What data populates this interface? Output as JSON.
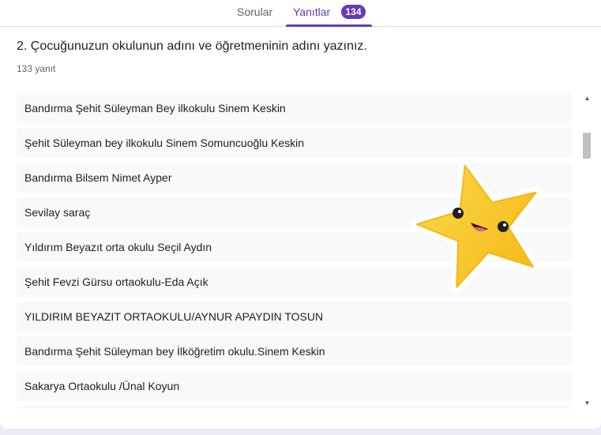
{
  "tabs": {
    "questions_label": "Sorular",
    "responses_label": "Yanıtlar",
    "responses_count": "134"
  },
  "question": {
    "title": "2. Çocuğunuzun okulunun adını ve öğretmeninin adını yazınız.",
    "response_count": "133 yanıt"
  },
  "answers": [
    "Bandırma Şehit Süleyman Bey ilkokulu Sinem Keskin",
    "Şehit Süleyman bey ilkokulu Sinem Somuncuoğlu Keskin",
    "Bandırma Bilsem Nimet Ayper",
    "Sevilay saraç",
    "Yıldırım Beyazıt orta okulu Seçil Aydın",
    "Şehit Fevzi Gürsu ortaokulu-Eda Açık",
    "YILDIRIM BEYAZIT ORTAOKULU/AYNUR APAYDIN TOSUN",
    "Bandırma Şehit Süleyman bey İlköğretim okulu.Sinem Keskin",
    "Sakarya Ortaokulu /Ünal Koyun",
    ""
  ],
  "sticker": {
    "icon": "smiling-star-sticker",
    "color": "#f9c938"
  },
  "colors": {
    "accent": "#673ab7",
    "page_bg": "#f0ebf8"
  }
}
